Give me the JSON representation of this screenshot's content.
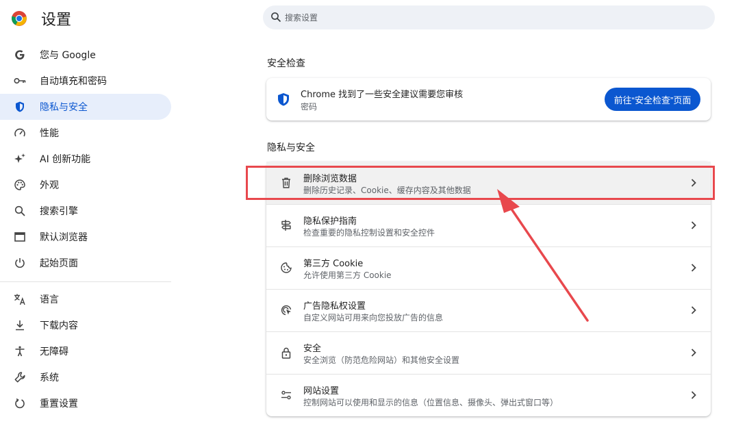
{
  "app": {
    "title": "设置"
  },
  "search": {
    "placeholder": "搜索设置"
  },
  "sidebar": {
    "items": [
      {
        "label": "您与 Google",
        "icon": "google-icon"
      },
      {
        "label": "自动填充和密码",
        "icon": "key-icon"
      },
      {
        "label": "隐私与安全",
        "icon": "shield-icon",
        "active": true
      },
      {
        "label": "性能",
        "icon": "speedometer-icon"
      },
      {
        "label": "AI 创新功能",
        "icon": "sparkle-icon"
      },
      {
        "label": "外观",
        "icon": "palette-icon"
      },
      {
        "label": "搜索引擎",
        "icon": "search-icon"
      },
      {
        "label": "默认浏览器",
        "icon": "browser-window-icon"
      },
      {
        "label": "起始页面",
        "icon": "power-icon"
      }
    ],
    "items2": [
      {
        "label": "语言",
        "icon": "translate-icon"
      },
      {
        "label": "下载内容",
        "icon": "download-icon"
      },
      {
        "label": "无障碍",
        "icon": "accessibility-icon"
      },
      {
        "label": "系统",
        "icon": "wrench-icon"
      },
      {
        "label": "重置设置",
        "icon": "reset-icon"
      }
    ]
  },
  "safety_check": {
    "section_title": "安全检查",
    "line1": "Chrome 找到了一些安全建议需要您审核",
    "line2": "密码",
    "button_label": "前往“安全检查”页面"
  },
  "privacy": {
    "section_title": "隐私与安全",
    "rows": [
      {
        "title": "删除浏览数据",
        "subtitle": "删除历史记录、Cookie、缓存内容及其他数据",
        "icon": "trash-icon",
        "highlighted": true
      },
      {
        "title": "隐私保护指南",
        "subtitle": "检查重要的隐私控制设置和安全控件",
        "icon": "signpost-icon"
      },
      {
        "title": "第三方 Cookie",
        "subtitle": "允许使用第三方 Cookie",
        "icon": "cookie-icon"
      },
      {
        "title": "广告隐私权设置",
        "subtitle": "自定义网站可用来向您投放广告的信息",
        "icon": "ads-privacy-icon"
      },
      {
        "title": "安全",
        "subtitle": "安全浏览（防范危险网站）和其他安全设置",
        "icon": "lock-icon"
      },
      {
        "title": "网站设置",
        "subtitle": "控制网站可以使用和显示的信息（位置信息、摄像头、弹出式窗口等）",
        "icon": "tune-icon"
      }
    ]
  },
  "colors": {
    "accent": "#0b57d0",
    "active_bg": "#e7eefb",
    "annotation": "#e8484d"
  }
}
